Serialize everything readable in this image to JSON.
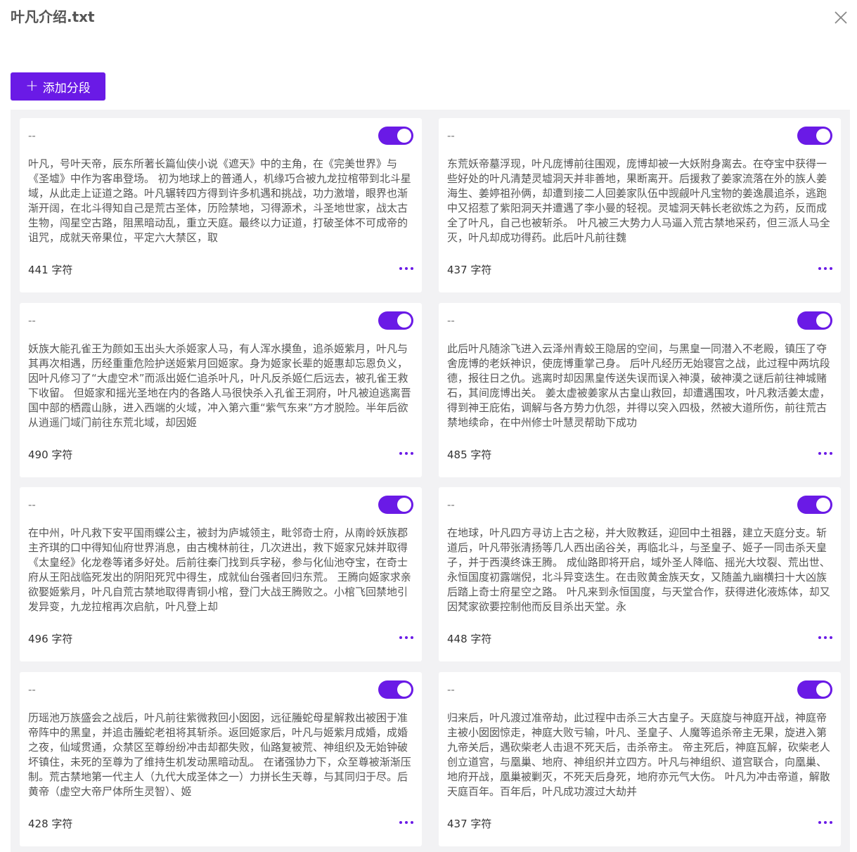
{
  "header": {
    "title": "叶凡介绍.txt"
  },
  "toolbar": {
    "add_label": "添加分段"
  },
  "colors": {
    "accent": "#6a1ae6",
    "grid_background": "#f2f2f4"
  },
  "segments": [
    {
      "title": "--",
      "count": "441 字符",
      "text": "叶凡，号叶天帝，辰东所著长篇仙侠小说《遮天》中的主角，在《完美世界》与《圣墟》中作为客串登场。 初为地球上的普通人，机缘巧合被九龙拉棺带到北斗星域，从此走上证道之路。叶凡辗转四方得到许多机遇和挑战，功力激增，眼界也渐渐开阔，在北斗得知自己是荒古圣体，历险禁地，习得源术，斗圣地世家，战太古生物，闯星空古路，阻黑暗动乱，重立天庭。最终以力证道，打破圣体不可成帝的诅咒，成就天帝果位，平定六大禁区，取"
    },
    {
      "title": "--",
      "count": "437 字符",
      "text": "东荒妖帝墓浮现，叶凡庞博前往围观，庞博却被一大妖附身离去。在夺宝中获得一些好处的叶凡清楚灵墟洞天并非善地，果断离开。后援救了姜家流落在外的族人姜海生、姜婷祖孙俩，却遭到接二人回姜家队伍中觊觎叶凡宝物的姜逸晨追杀，逃跑中又招惹了紫阳洞天并遭遇了李小曼的轻视。灵墟洞天韩长老欲炼之为药，反而成全了叶凡，自己也被斩杀。 叶凡被三大势力人马逼入荒古禁地采药，但三派人马全灭，叶凡却成功得药。此后叶凡前往魏"
    },
    {
      "title": "--",
      "count": "490 字符",
      "text": "妖族大能孔雀王为颜如玉出头大杀姬家人马，有人浑水摸鱼，追杀姬紫月，叶凡与其再次相遇，历经重重危险护送姬紫月回姬家。身为姬家长辈的姬惠却忘恩负义，因叶凡修习了“大虚空术”而派出姬仁追杀叶凡，叶凡反杀姬仁后远去，被孔雀王救下收留。 但姬家和摇光圣地在内的各路人马很快杀入孔雀王洞府，叶凡被迫逃离晋国中部的栖霞山脉，进入西端的火域，冲入第六重“紫气东来”方才脱险。半年后欲从逍遥门域门前往东荒北域，却因姬"
    },
    {
      "title": "--",
      "count": "485 字符",
      "text": "此后叶凡随涂飞进入云泽州青蛟王隐居的空间，与黑皇一同潜入不老殿，镇压了夺舍庞博的老妖神识，使庞博重掌己身。 后叶凡经历无始寝宫之战，此过程中两坑段德，报往日之仇。逃离时却因黑皇传送失误而误入神漠，破神漠之谜后前往神城赌石，其间庞博出关。 姜太虚被姜家从古皇山救回，却遭遇围攻，叶凡救活姜太虚，得到神王庇佑，调解与各方势力仇怨，并得以突入四极，然被大道所伤，前往荒古禁地续命，在中州修士叶慧灵帮助下成功"
    },
    {
      "title": "--",
      "count": "496 字符",
      "text": "在中州，叶凡救下安平国雨蝶公主，被封为庐城领主，毗邻奇士府，从南岭妖族郡主齐琪的口中得知仙府世界消息，由古槐林前往，几次进出，救下姬家兄妹并取得《太皇经》化龙卷等诸多好处。后前往秦门找到兵字秘，参与化仙池夺宝，在奇士府从王阳战临死发出的阴阳死咒中得生，成就仙台强者回归东荒。 王腾向姬家求亲欲娶姬紫月，叶凡自荒古禁地取得青铜小棺，登门大战王腾败之。小棺飞回禁地引发异变，九龙拉棺再次启航，叶凡登上却"
    },
    {
      "title": "--",
      "count": "448 字符",
      "text": "在地球，叶凡四方寻访上古之秘，并大败教廷，迎回中土祖器，建立天庭分支。斩道后，叶凡带张清扬等几人西出函谷关，再临北斗，与圣皇子、姬子一同击杀天皇子，并于西漠终诛王腾。 成仙路即将开启，域外圣人降临、摇光大坟裂、荒出世、永恒国度初露端倪，北斗异变迭生。在击败黄金族天女，又随盖九幽横扫十大凶族后踏上奇士府星空之路。 叶凡来到永恒国度，与天堂合作，获得进化液炼体，却又因梵家欲要控制他而反目杀出天堂。永"
    },
    {
      "title": "--",
      "count": "428 字符",
      "text": "历瑶池万族盛会之战后，叶凡前往紫微救回小囡囡，远征螣蛇母星解救出被困于准帝阵中的黑皇，并追击螣蛇老祖将其斩杀。返回姬家后，叶凡与姬紫月成婚，成婚之夜，仙域贯通，众禁区至尊纷纷冲击却都失败，仙路复被荒、神组织及无始钟破坏镇住，未死的至尊为了维持生机发动黑暗动乱。 在诸强协力下，众至尊被渐渐压制。荒古禁地第一代主人（九代大成圣体之一）力拼长生天尊，与其同归于尽。后黄帝（虚空大帝尸体所生灵智）、姬"
    },
    {
      "title": "--",
      "count": "437 字符",
      "text": "归来后，叶凡渡过准帝劫，此过程中击杀三大古皇子。天庭旋与神庭开战，神庭帝主被小囡囡惊走，神庭大败亏输，叶凡、圣皇子、人魔等追杀帝主无果，旋进入第九帝关后，遇砍柴老人击退不死天后，击杀帝主。 帝主死后，神庭瓦解，砍柴老人创立道宫，与凰巢、地府、神组织并立四方。叶凡与神组织、道宫联合，向凰巢、地府开战，凰巢被剿灭，不死天后身死，地府亦元气大伤。 叶凡为冲击帝道，解散天庭百年。百年后，叶凡成功渡过大劫并"
    }
  ]
}
